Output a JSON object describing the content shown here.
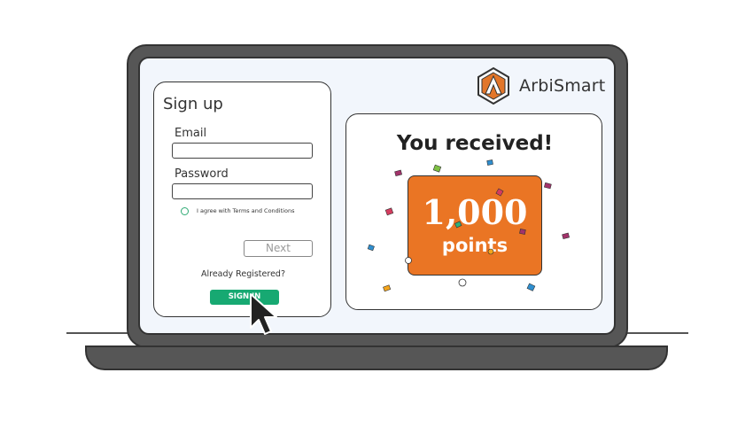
{
  "brand": {
    "name": "ArbiSmart",
    "color": "#e2762a"
  },
  "signup": {
    "title": "Sign up",
    "email_label": "Email",
    "email_value": "",
    "password_label": "Password",
    "password_value": "",
    "agree_text": "I agree with Terms and Conditions",
    "next_label": "Next",
    "already_text": "Already Registered?",
    "signin_label": "SIGN IN"
  },
  "reward": {
    "title": "You received!",
    "amount": "1,000",
    "unit": "points"
  },
  "colors": {
    "accent_green": "#17a972",
    "reward_orange": "#ea7524",
    "laptop_body": "#565656",
    "screen_bg": "#f2f6fc"
  },
  "icons": [
    "arbismart-logo-icon",
    "cursor-arrow-icon",
    "radio-icon"
  ]
}
